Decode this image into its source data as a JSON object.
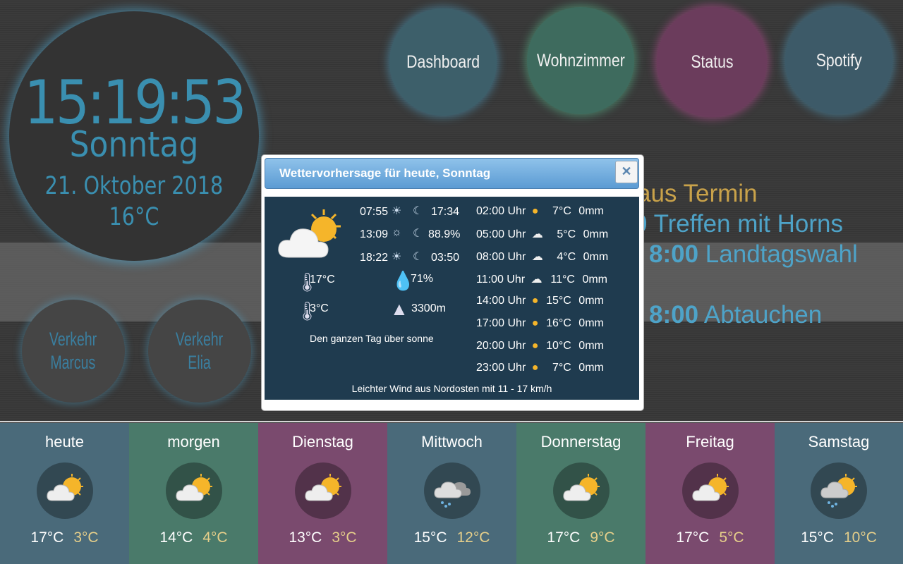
{
  "clock": {
    "time": "15:19:53",
    "day": "Sonntag",
    "date": "21. Oktober 2018",
    "temp": "16°C"
  },
  "nav": [
    {
      "label": "Dashboard",
      "color": "#3d5f6a"
    },
    {
      "label": "Wohnzimmer",
      "color": "#3e6b5e"
    },
    {
      "label": "Status",
      "color": "#6b3c5c"
    },
    {
      "label": "Spotify",
      "color": "#3d5a68"
    }
  ],
  "traffic": [
    {
      "line1": "Verkehr",
      "line2": "Marcus"
    },
    {
      "line1": "Verkehr",
      "line2": "Elia"
    }
  ],
  "calendar": [
    {
      "time": "",
      "text": "aus Termin",
      "color": "#c9a24a"
    },
    {
      "time": "0",
      "text": "Treffen mit Horns",
      "color": "#4ea3c8"
    },
    {
      "time": "8:00",
      "text": "Landtagswahl",
      "color": "#4ea3c8"
    },
    {
      "time": "8:00",
      "text": "Abtauchen",
      "color": "#4ea3c8"
    }
  ],
  "dialog": {
    "title": "Wettervorhersage für heute, Sonntag",
    "close_icon": "close-icon",
    "sun": {
      "rise": "07:55",
      "moonrise": "17:34",
      "noon": "13:09",
      "moon_illum": "88.9%",
      "set": "18:22",
      "moonset": "03:50"
    },
    "temp_max": "17°C",
    "temp_min": "3°C",
    "humidity": "71%",
    "snowline": "3300m",
    "summary": "Den ganzen Tag über sonne",
    "wind": "Leichter Wind aus Nordosten mit 11 - 17 km/h",
    "hourly": [
      {
        "time": "02:00 Uhr",
        "icon": "sun",
        "temp": "7°C",
        "rain": "0mm"
      },
      {
        "time": "05:00 Uhr",
        "icon": "cloud-sun",
        "temp": "5°C",
        "rain": "0mm"
      },
      {
        "time": "08:00 Uhr",
        "icon": "cloud-sun",
        "temp": "4°C",
        "rain": "0mm"
      },
      {
        "time": "11:00 Uhr",
        "icon": "cloud-sun",
        "temp": "11°C",
        "rain": "0mm"
      },
      {
        "time": "14:00 Uhr",
        "icon": "sun",
        "temp": "15°C",
        "rain": "0mm"
      },
      {
        "time": "17:00 Uhr",
        "icon": "sun",
        "temp": "16°C",
        "rain": "0mm"
      },
      {
        "time": "20:00 Uhr",
        "icon": "sun",
        "temp": "10°C",
        "rain": "0mm"
      },
      {
        "time": "23:00 Uhr",
        "icon": "sun",
        "temp": "7°C",
        "rain": "0mm"
      }
    ]
  },
  "forecast": [
    {
      "day": "heute",
      "hi": "17°C",
      "lo": "3°C",
      "icon": "cloud-sun",
      "color": "#4a6a7a"
    },
    {
      "day": "morgen",
      "hi": "14°C",
      "lo": "4°C",
      "icon": "cloud-sun",
      "color": "#4a7a6a"
    },
    {
      "day": "Dienstag",
      "hi": "13°C",
      "lo": "3°C",
      "icon": "cloud-sun",
      "color": "#7a4a6e"
    },
    {
      "day": "Mittwoch",
      "hi": "15°C",
      "lo": "12°C",
      "icon": "rain-cloud",
      "color": "#4a6a7a"
    },
    {
      "day": "Donnerstag",
      "hi": "17°C",
      "lo": "9°C",
      "icon": "cloud-sun",
      "color": "#4a7a6a"
    },
    {
      "day": "Freitag",
      "hi": "17°C",
      "lo": "5°C",
      "icon": "cloud-sun",
      "color": "#7a4a6e"
    },
    {
      "day": "Samstag",
      "hi": "15°C",
      "lo": "10°C",
      "icon": "rain-cloud-sun",
      "color": "#4a6a7a"
    }
  ]
}
